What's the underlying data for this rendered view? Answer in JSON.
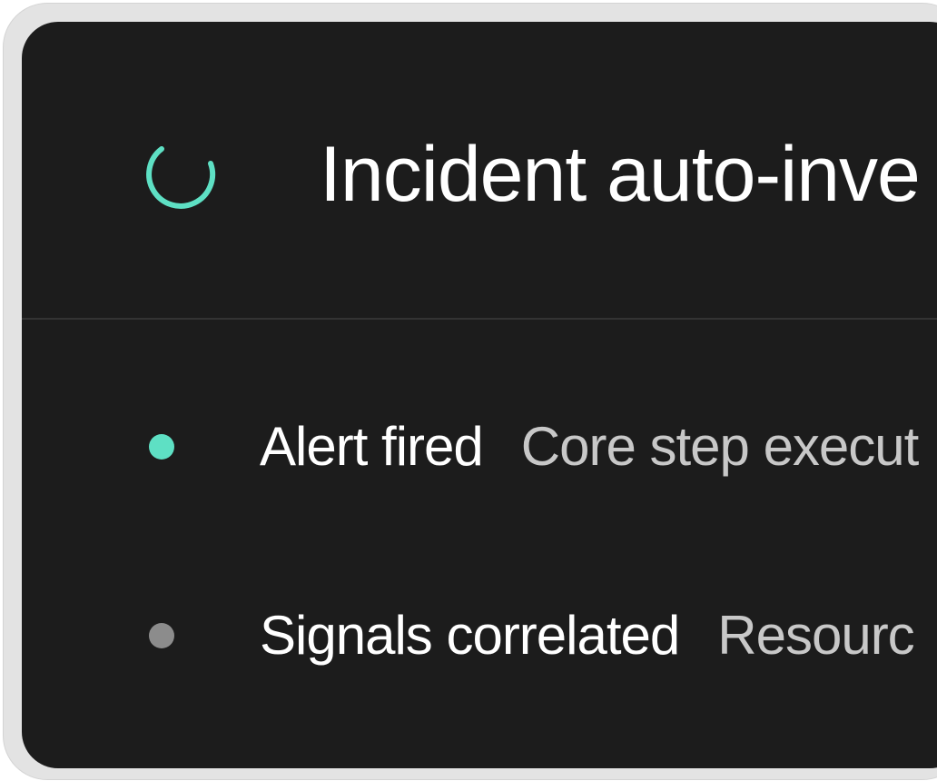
{
  "panel": {
    "title": "Incident auto-inve",
    "spinner_icon": "loading-spinner-icon",
    "accent_color": "#5ee0c4"
  },
  "steps": [
    {
      "title": "Alert fired",
      "description": "Core step execut",
      "status_color": "#5ee0c4"
    },
    {
      "title": "Signals correlated",
      "description": "Resourc",
      "status_color": "#8c8c8c"
    }
  ]
}
